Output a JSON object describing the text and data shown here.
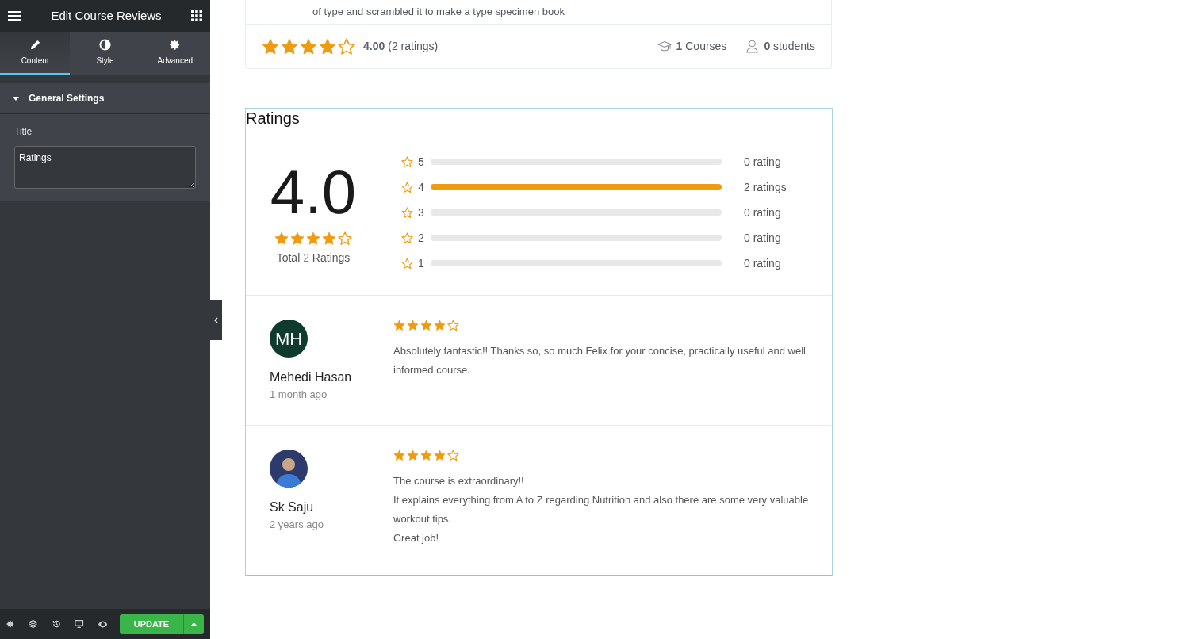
{
  "editor": {
    "title": "Edit Course Reviews",
    "tabs": [
      {
        "label": "Content",
        "selected": true
      },
      {
        "label": "Style",
        "selected": false
      },
      {
        "label": "Advanced",
        "selected": false
      }
    ],
    "section": {
      "title": "General Settings",
      "expanded": true
    },
    "field": {
      "label": "Title",
      "value": "Ratings"
    },
    "update_label": "UPDATE"
  },
  "instructor_card": {
    "description": "of type and scrambled it to make a type specimen book",
    "stars": 4,
    "rating": "4.00",
    "ratings_count": "(2 ratings)",
    "courses_count": "1",
    "courses_label": "Courses",
    "students_count": "0",
    "students_label": "students"
  },
  "ratings_widget": {
    "title": "Ratings",
    "average": "4.0",
    "stars": 4,
    "total_prefix": "Total",
    "total_count": "2",
    "total_suffix": "Ratings",
    "breakdown": [
      {
        "star": "5",
        "level": 0,
        "label": "0 rating"
      },
      {
        "star": "4",
        "level": 1,
        "label": "2 ratings"
      },
      {
        "star": "3",
        "level": 0,
        "label": "0 rating"
      },
      {
        "star": "2",
        "level": 0,
        "label": "0 rating"
      },
      {
        "star": "1",
        "level": 0,
        "label": "0 rating"
      }
    ],
    "reviews": [
      {
        "kind": "initials",
        "initials": "MH",
        "name": "Mehedi Hasan",
        "time": "1 month ago",
        "stars": 4,
        "lines": [
          "Absolutely fantastic!! Thanks so, so much Felix for your concise, practically useful and well informed course."
        ]
      },
      {
        "kind": "photo",
        "name": "Sk Saju",
        "time": "2 years ago",
        "stars": 4,
        "lines": [
          "The course is extraordinary!!",
          "It explains everything from A to Z regarding Nutrition and also there are some very valuable workout tips.",
          "Great job!"
        ]
      }
    ]
  }
}
